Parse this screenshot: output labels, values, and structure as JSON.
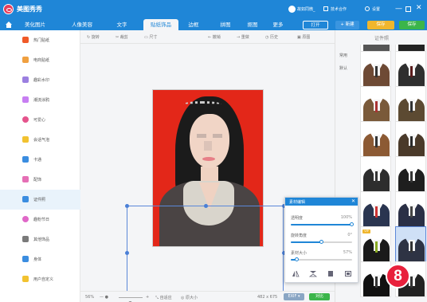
{
  "app": {
    "title": "美图秀秀"
  },
  "titlebar": {
    "user_name": "故如同微_",
    "links": [
      "技术合作",
      "设置"
    ],
    "window_controls": [
      "minimize-icon",
      "maximize-icon",
      "close-icon"
    ]
  },
  "nav": {
    "tabs": [
      "美化图片",
      "人像美容",
      "文字",
      "贴纸饰品",
      "边框",
      "拼图",
      "抠图",
      "更多"
    ],
    "active_tab": "贴纸饰品",
    "open_label": "打开",
    "new_label": "新建",
    "save_as_label": "保存",
    "save_label": "保存"
  },
  "sidebar": {
    "items": [
      {
        "label": "热门贴纸",
        "icon": "flame-icon",
        "color": "#f05a28"
      },
      {
        "label": "电商贴纸",
        "icon": "shop-icon",
        "color": "#f0a040"
      },
      {
        "label": "趣彩水印",
        "icon": "watermark-icon",
        "color": "#9b7fe0"
      },
      {
        "label": "潮流涂鸦",
        "icon": "graffiti-icon",
        "color": "#c77ef2"
      },
      {
        "label": "可爱心",
        "icon": "heart-icon",
        "color": "#e5548c"
      },
      {
        "label": "会话气泡",
        "icon": "bubble-icon",
        "color": "#f2c230"
      },
      {
        "label": "卡通",
        "icon": "cartoon-icon",
        "color": "#3b8de0"
      },
      {
        "label": "配饰",
        "icon": "accessory-icon",
        "color": "#e56fb5"
      },
      {
        "label": "证件照",
        "icon": "id-photo-icon",
        "color": "#3b8de0",
        "active": true
      },
      {
        "label": "趣粉节日",
        "icon": "festival-icon",
        "color": "#e068c8"
      },
      {
        "label": "其他饰品",
        "icon": "grid-icon",
        "color": "#7a7a7a"
      },
      {
        "label": "身体",
        "icon": "body-icon",
        "color": "#3b8de0"
      },
      {
        "label": "用户自定义",
        "icon": "custom-icon",
        "color": "#f2c230"
      }
    ]
  },
  "toolbar": {
    "rotate": "旋转",
    "crop": "裁剪",
    "size": "尺寸",
    "undo": "撤销",
    "redo": "重做",
    "history": "历史",
    "original": "原图"
  },
  "status": {
    "zoom": "56%",
    "fit": "自适应",
    "original_size": "原大小",
    "dimensions": "482 x 675",
    "exif": "EXIF",
    "compare": "对比"
  },
  "editor": {
    "title": "素材编辑",
    "opacity_label": "透明度",
    "opacity_value": "100%",
    "opacity": 1.0,
    "rotate_label": "旋转角度",
    "rotate_value": "0°",
    "rotate": 0.5,
    "size_label": "素材大小",
    "size_value": "57%",
    "size": 0.11
  },
  "right_panel": {
    "title": "证件照",
    "tabs": [
      "常用",
      "默认"
    ],
    "thumbnails": [
      {
        "body": "#555555",
        "tie": "#2a2a2a"
      },
      {
        "body": "#222222",
        "tie": "#7a1a1a"
      },
      {
        "body": "#6e4a35",
        "tie": "#333333"
      },
      {
        "body": "#2f2f2f",
        "tie": "#5a1c1c"
      },
      {
        "body": "#7a5a3a",
        "tie": "#a33"
      },
      {
        "body": "#5c4a32",
        "tie": "#333"
      },
      {
        "body": "#8c5a34",
        "tie": "#333"
      },
      {
        "body": "#4a3a2a",
        "tie": "#2a2a2a"
      },
      {
        "body": "#2d2d2d",
        "tie": "#333"
      },
      {
        "body": "#1e1e1e",
        "tie": "#333"
      },
      {
        "body": "#2a3550",
        "tie": "#c33"
      },
      {
        "body": "#2a2f45",
        "tie": "#444"
      },
      {
        "body": "#1a1a1a",
        "tie": "#8a2"
      },
      {
        "body": "#2e3344",
        "tie": "#333"
      },
      {
        "body": "#111111",
        "tie": "#333"
      },
      {
        "body": "#222222",
        "tie": "#333"
      }
    ],
    "vip_badge": "VIP"
  },
  "step_badge": "8",
  "colors": {
    "brand": "#1f86d7",
    "accent_green": "#3bb54a",
    "accent_orange": "#f0b62d",
    "badge_red": "#e8203c"
  }
}
